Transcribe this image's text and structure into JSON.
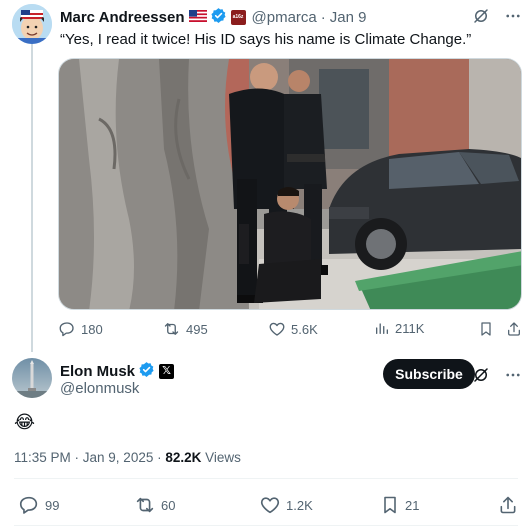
{
  "parent_tweet": {
    "author_name": "Marc Andreessen",
    "handle": "@pmarca",
    "separator": "·",
    "date": "Jan 9",
    "text": "“Yes, I read it twice! His ID says his name is Climate Change.”",
    "media_icon": "photo",
    "actions": {
      "replies": "180",
      "reposts": "495",
      "likes": "5.6K",
      "views": "211K"
    }
  },
  "main_tweet": {
    "author_name": "Elon Musk",
    "handle": "@elonmusk",
    "subscribe_label": "Subscribe",
    "text": "😂",
    "time": "11:35 PM · Jan 9, 2025 · ",
    "views_count": "82.2K",
    "views_label": " Views",
    "actions": {
      "replies": "99",
      "reposts": "60",
      "likes": "1.2K",
      "bookmarks": "21"
    }
  },
  "colors": {
    "text_primary": "#0f1419",
    "text_secondary": "#536471",
    "verified_blue": "#1d9bf0",
    "divider": "#eff3f4"
  }
}
